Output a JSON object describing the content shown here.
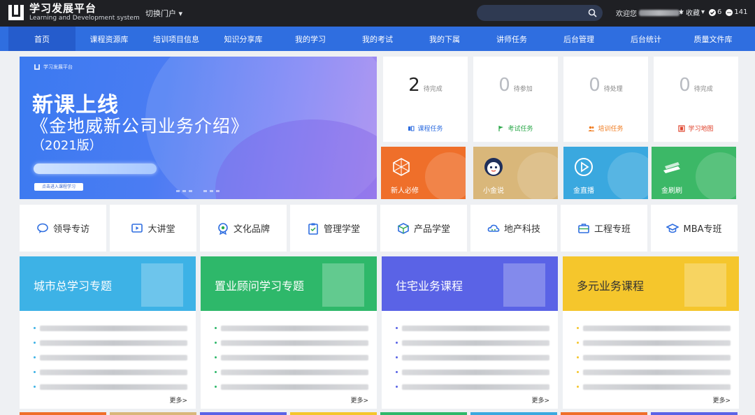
{
  "header": {
    "logo_cn": "学习发展平台",
    "logo_en": "Learning and Development system",
    "portal_switch": "切换门户",
    "search_placeholder": "",
    "welcome": "欢迎您",
    "favorites": "收藏",
    "count_a": "6",
    "count_b": "141"
  },
  "nav": {
    "items": [
      "首页",
      "课程资源库",
      "培训项目信息",
      "知识分享库",
      "我的学习",
      "我的考试",
      "我的下属",
      "讲师任务",
      "后台管理",
      "后台统计",
      "质量文件库"
    ],
    "active_index": 0
  },
  "banner": {
    "logo_text": "学习发展平台",
    "title": "新课上线",
    "subtitle": "《金地威新公司业务介绍》",
    "year": "（2021版）",
    "button": "点击进入课程学习"
  },
  "stats": [
    {
      "value": "2",
      "label": "待完成",
      "link": "课程任务",
      "link_color": "#2f6ee0",
      "icon": "book-icon"
    },
    {
      "value": "0",
      "label": "待参加",
      "link": "考试任务",
      "link_color": "#2ba84a",
      "icon": "flag-icon"
    },
    {
      "value": "0",
      "label": "待处理",
      "link": "培训任务",
      "link_color": "#f07d22",
      "icon": "people-icon"
    },
    {
      "value": "0",
      "label": "待完成",
      "link": "学习地图",
      "link_color": "#e0452f",
      "icon": "map-icon"
    }
  ],
  "tiles": [
    {
      "label": "新人必修",
      "color": "#ef6f2a",
      "icon": "cube-icon"
    },
    {
      "label": "小金说",
      "color": "#d9b77a",
      "icon": "mascot-icon"
    },
    {
      "label": "金直播",
      "color": "#3aa8df",
      "icon": "play-icon"
    },
    {
      "label": "金刷刷",
      "color": "#3cb867",
      "icon": "books-icon"
    }
  ],
  "categories": [
    {
      "label": "领导专访",
      "icon": "chat-icon"
    },
    {
      "label": "大讲堂",
      "icon": "video-icon"
    },
    {
      "label": "文化品牌",
      "icon": "badge-icon"
    },
    {
      "label": "管理学堂",
      "icon": "clipboard-icon"
    },
    {
      "label": "产品学堂",
      "icon": "box-icon"
    },
    {
      "label": "地产科技",
      "icon": "cloud-icon"
    },
    {
      "label": "工程专班",
      "icon": "briefcase-icon"
    },
    {
      "label": "MBA专班",
      "icon": "graduation-icon"
    }
  ],
  "topics": [
    {
      "title": "城市总学习专题",
      "color": "#3db2e6",
      "bullet": "#3db2e6",
      "more": "更多>"
    },
    {
      "title": "置业顾问学习专题",
      "color": "#2eb86a",
      "bullet": "#2eb86a",
      "more": "更多>"
    },
    {
      "title": "住宅业务课程",
      "color": "#5a63e6",
      "bullet": "#5a63e6",
      "more": "更多>"
    },
    {
      "title": "多元业务课程",
      "color": "#f5c62c",
      "bullet": "#f5c62c",
      "more": "更多>"
    }
  ],
  "colors": {
    "header_bg": "#1f2024",
    "nav_bg": "#2f6ee0",
    "page_bg": "#eef0f3"
  }
}
